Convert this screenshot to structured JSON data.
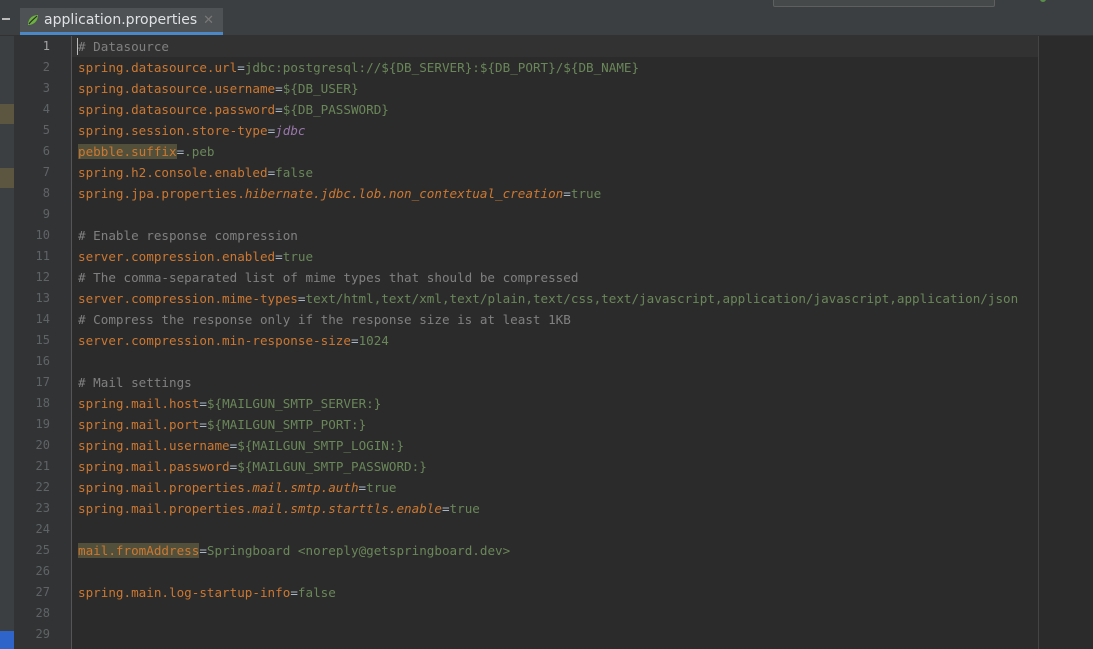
{
  "editor_tab": {
    "filename": "application.properties"
  },
  "lines": [
    {
      "n": "1",
      "parts": [
        {
          "t": "# Datasource",
          "c": "cm"
        }
      ]
    },
    {
      "n": "2",
      "parts": [
        {
          "t": "spring.datasource.url",
          "c": "key"
        },
        {
          "t": "=",
          "c": "op"
        },
        {
          "t": "jdbc:postgresql://${DB_SERVER}:${DB_PORT}/${DB_NAME}",
          "c": "val"
        }
      ]
    },
    {
      "n": "3",
      "parts": [
        {
          "t": "spring.datasource.username",
          "c": "key"
        },
        {
          "t": "=",
          "c": "op"
        },
        {
          "t": "${DB_USER}",
          "c": "val"
        }
      ]
    },
    {
      "n": "4",
      "parts": [
        {
          "t": "spring.datasource.password",
          "c": "key"
        },
        {
          "t": "=",
          "c": "op"
        },
        {
          "t": "${DB_PASSWORD}",
          "c": "val"
        }
      ]
    },
    {
      "n": "5",
      "parts": [
        {
          "t": "spring.session.store-type",
          "c": "key"
        },
        {
          "t": "=",
          "c": "op"
        },
        {
          "t": "jdbc",
          "c": "vit"
        }
      ]
    },
    {
      "n": "6",
      "parts": [
        {
          "t": "pebble.suffix",
          "c": "key-hl"
        },
        {
          "t": "=",
          "c": "op"
        },
        {
          "t": ".peb",
          "c": "val"
        }
      ]
    },
    {
      "n": "7",
      "parts": [
        {
          "t": "spring.h2.console.enabled",
          "c": "key"
        },
        {
          "t": "=",
          "c": "op"
        },
        {
          "t": "false",
          "c": "val"
        }
      ]
    },
    {
      "n": "8",
      "parts": [
        {
          "t": "spring.jpa.properties.",
          "c": "key"
        },
        {
          "t": "hibernate.jdbc.lob.non_contextual_creation",
          "c": "kit"
        },
        {
          "t": "=",
          "c": "op"
        },
        {
          "t": "true",
          "c": "val"
        }
      ]
    },
    {
      "n": "9",
      "parts": []
    },
    {
      "n": "10",
      "parts": [
        {
          "t": "# Enable response compression",
          "c": "cm"
        }
      ]
    },
    {
      "n": "11",
      "parts": [
        {
          "t": "server.compression.enabled",
          "c": "key"
        },
        {
          "t": "=",
          "c": "op"
        },
        {
          "t": "true",
          "c": "val"
        }
      ]
    },
    {
      "n": "12",
      "parts": [
        {
          "t": "# The comma-separated list of mime types that should be compressed",
          "c": "cm"
        }
      ]
    },
    {
      "n": "13",
      "parts": [
        {
          "t": "server.compression.mime-types",
          "c": "key"
        },
        {
          "t": "=",
          "c": "op"
        },
        {
          "t": "text/html,text/xml,text/plain,text/css,text/javascript,application/javascript,application/json",
          "c": "val"
        }
      ]
    },
    {
      "n": "14",
      "parts": [
        {
          "t": "# Compress the response only if the response size is at least 1KB",
          "c": "cm"
        }
      ]
    },
    {
      "n": "15",
      "parts": [
        {
          "t": "server.compression.min-response-size",
          "c": "key"
        },
        {
          "t": "=",
          "c": "op"
        },
        {
          "t": "1024",
          "c": "val"
        }
      ]
    },
    {
      "n": "16",
      "parts": []
    },
    {
      "n": "17",
      "parts": [
        {
          "t": "# Mail settings",
          "c": "cm"
        }
      ]
    },
    {
      "n": "18",
      "parts": [
        {
          "t": "spring.mail.host",
          "c": "key"
        },
        {
          "t": "=",
          "c": "op"
        },
        {
          "t": "${MAILGUN_SMTP_SERVER:}",
          "c": "val"
        }
      ]
    },
    {
      "n": "19",
      "parts": [
        {
          "t": "spring.mail.port",
          "c": "key"
        },
        {
          "t": "=",
          "c": "op"
        },
        {
          "t": "${MAILGUN_SMTP_PORT:}",
          "c": "val"
        }
      ]
    },
    {
      "n": "20",
      "parts": [
        {
          "t": "spring.mail.username",
          "c": "key"
        },
        {
          "t": "=",
          "c": "op"
        },
        {
          "t": "${MAILGUN_SMTP_LOGIN:}",
          "c": "val"
        }
      ]
    },
    {
      "n": "21",
      "parts": [
        {
          "t": "spring.mail.password",
          "c": "key"
        },
        {
          "t": "=",
          "c": "op"
        },
        {
          "t": "${MAILGUN_SMTP_PASSWORD:}",
          "c": "val"
        }
      ]
    },
    {
      "n": "22",
      "parts": [
        {
          "t": "spring.mail.properties.",
          "c": "key"
        },
        {
          "t": "mail.smtp.auth",
          "c": "kit"
        },
        {
          "t": "=",
          "c": "op"
        },
        {
          "t": "true",
          "c": "val"
        }
      ]
    },
    {
      "n": "23",
      "parts": [
        {
          "t": "spring.mail.properties.",
          "c": "key"
        },
        {
          "t": "mail.smtp.starttls.enable",
          "c": "kit"
        },
        {
          "t": "=",
          "c": "op"
        },
        {
          "t": "true",
          "c": "val"
        }
      ]
    },
    {
      "n": "24",
      "parts": []
    },
    {
      "n": "25",
      "parts": [
        {
          "t": "mail.fromAddress",
          "c": "key-hl"
        },
        {
          "t": "=",
          "c": "op"
        },
        {
          "t": "Springboard <noreply@getspringboard.dev>",
          "c": "val"
        }
      ]
    },
    {
      "n": "26",
      "parts": []
    },
    {
      "n": "27",
      "parts": [
        {
          "t": "spring.main.log-startup-info",
          "c": "key"
        },
        {
          "t": "=",
          "c": "op"
        },
        {
          "t": "false",
          "c": "val"
        }
      ]
    },
    {
      "n": "28",
      "parts": []
    },
    {
      "n": "29",
      "parts": []
    }
  ],
  "icons": {
    "tab_icon": "spring-leaf-icon",
    "tab_close": "close-icon",
    "panel_collapse": "minimize-icon"
  },
  "colors": {
    "key": "#cc7832",
    "value": "#6a8759",
    "comment": "#808080",
    "italic_value": "#9876aa",
    "background": "#2b2b2b"
  }
}
